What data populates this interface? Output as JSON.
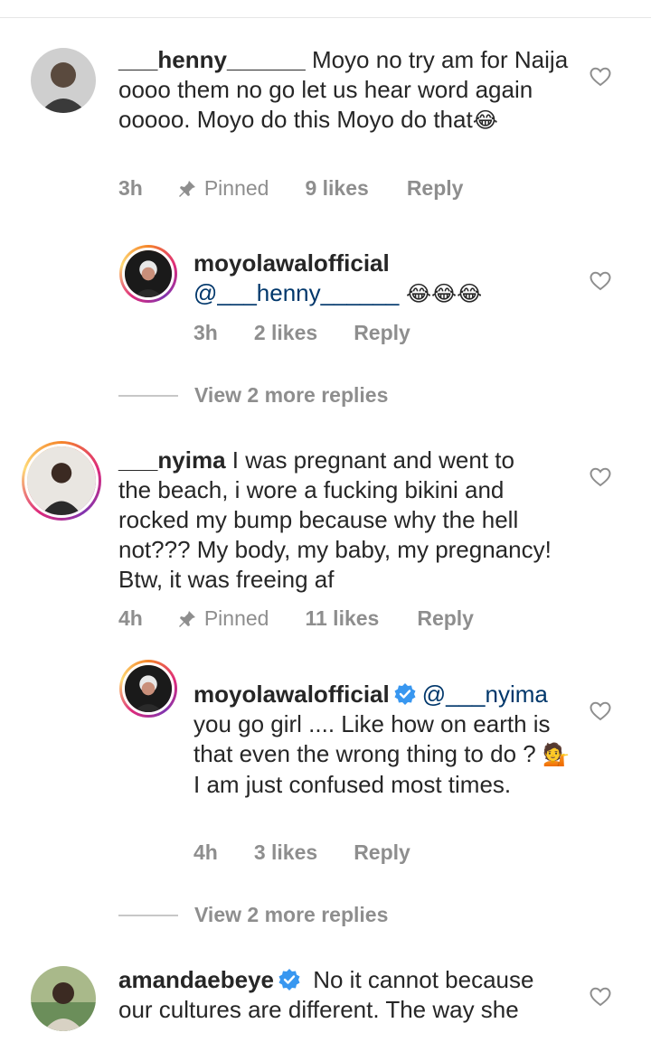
{
  "comments": [
    {
      "username": "___henny______",
      "text": " Moyo no try am for Naija oooo them no go let us hear word again ooooo. Moyo do this Moyo do that",
      "emoji": "😂",
      "time": "3h",
      "pinned": "Pinned",
      "likes": "9 likes",
      "reply": "Reply"
    },
    {
      "username": "___nyima",
      "text": " I was pregnant and went to the beach, i wore a fucking bikini and rocked my bump because why the hell not??? My body, my baby, my pregnancy! Btw, it was freeing af",
      "time": "4h",
      "pinned": "Pinned",
      "likes": "11 likes",
      "reply": "Reply"
    },
    {
      "username": "amandaebeye",
      "text": " No it cannot because our cultures are different. The way she"
    }
  ],
  "replies": [
    {
      "username": "moyolawalofficial",
      "mention": "@___henny______",
      "emoji": " 😂😂😂",
      "time": "3h",
      "likes": "2 likes",
      "reply": "Reply",
      "view_more": "View 2 more replies"
    },
    {
      "username": "moyolawalofficial",
      "mention": "@___nyima",
      "text_before_emoji": "you go girl .... Like how on earth is that even the wrong thing to do ? ",
      "emoji": "💁",
      "text_after_emoji": " I am just confused most times.",
      "time": "4h",
      "likes": "3 likes",
      "reply": "Reply",
      "view_more": "View 2 more replies"
    }
  ],
  "colors": {
    "text": "#262626",
    "meta": "#8e8e8e",
    "mention": "#00376b",
    "verified": "#3897f0"
  }
}
